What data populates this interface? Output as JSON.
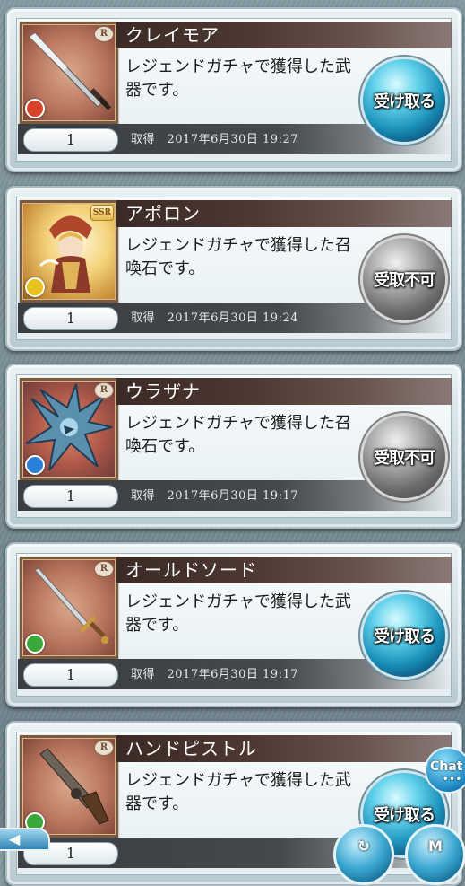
{
  "items": [
    {
      "name": "クレイモア",
      "description": "レジェンドガチャで獲得した武器です。",
      "quantity": "1",
      "acquired": "取得　2017年6月30日 19:27",
      "rarity": "R",
      "element": "fire",
      "element_color": "#d8442a",
      "button_label": "受け取る",
      "button_state": "enabled",
      "icon": "greatsword-icon"
    },
    {
      "name": "アポロン",
      "description": "レジェンドガチャで獲得した召喚石です。",
      "quantity": "1",
      "acquired": "取得　2017年6月30日 19:24",
      "rarity": "SSR",
      "element": "light",
      "element_color": "#e8c21f",
      "button_label": "受取不可",
      "button_state": "disabled",
      "icon": "apollo-summon-icon"
    },
    {
      "name": "ウラザナ",
      "description": "レジェンドガチャで獲得した召喚石です。",
      "quantity": "1",
      "acquired": "取得　2017年6月30日 19:17",
      "rarity": "R",
      "element": "water",
      "element_color": "#2a7fd8",
      "button_label": "受取不可",
      "button_state": "disabled",
      "icon": "dragon-summon-icon"
    },
    {
      "name": "オールドソード",
      "description": "レジェンドガチャで獲得した武器です。",
      "quantity": "1",
      "acquired": "取得　2017年6月30日 19:17",
      "rarity": "R",
      "element": "wind",
      "element_color": "#3aa83a",
      "button_label": "受け取る",
      "button_state": "enabled",
      "icon": "sword-icon"
    },
    {
      "name": "ハンドピストル",
      "description": "レジェンドガチャで獲得した武器です。",
      "quantity": "1",
      "acquired": "",
      "rarity": "R",
      "element": "wind",
      "element_color": "#3aa83a",
      "button_label": "受け取る",
      "button_state": "enabled",
      "icon": "pistol-icon"
    }
  ],
  "overlays": {
    "chat_label": "Chat",
    "chat_dots": "•••",
    "menu_label": "M",
    "back_arrow": "◀"
  }
}
